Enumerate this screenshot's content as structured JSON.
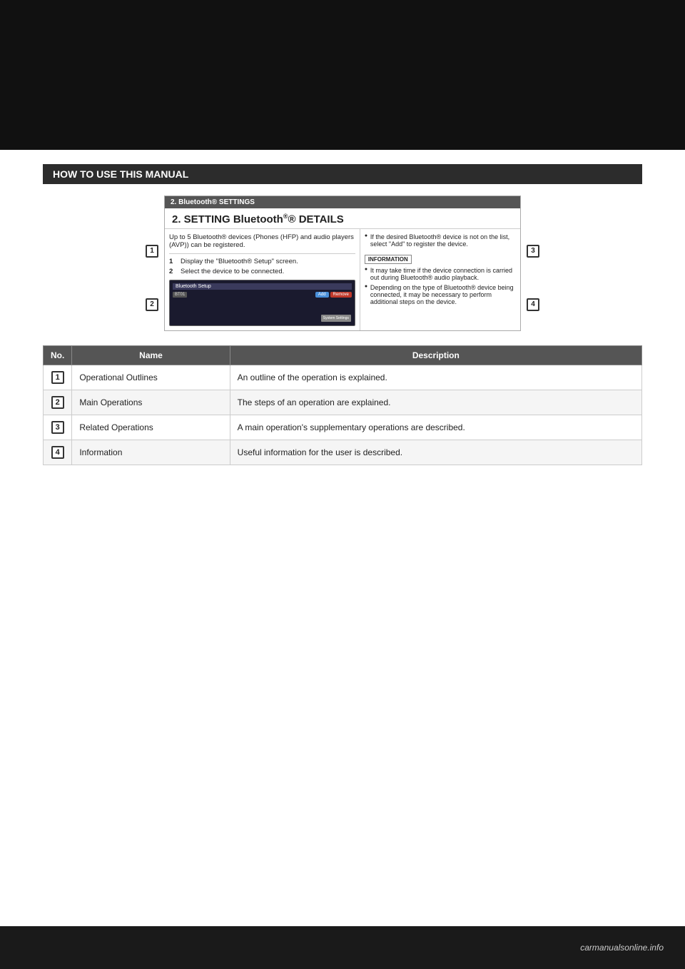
{
  "page": {
    "top_bar_height": 210,
    "section_header": "HOW TO USE THIS MANUAL",
    "diagram": {
      "subheader": "2. Bluetooth® SETTINGS",
      "title": "2. SETTING Bluetooth",
      "title_suffix": "® DETAILS",
      "left_panel": {
        "description": "Up to 5 Bluetooth® devices (Phones (HFP) and audio players (AVP)) can be registered.",
        "steps": [
          "Display the \"Bluetooth® Setup\" screen.",
          "Select the device to be connected."
        ]
      },
      "right_panel": {
        "bullet": "If the desired Bluetooth® device is not on the list, select \"Add\" to register the device.",
        "info_label": "INFORMATION",
        "info_bullets": [
          "It may take time if the device connection is carried out during Bluetooth® audio playback.",
          "Depending on the type of Bluetooth® device being connected, it may be necessary to perform additional steps on the device."
        ]
      },
      "screen_mock": {
        "header": "Bluetooth Setup",
        "item": "BT01",
        "btn_add": "Add",
        "btn_remove": "Remove",
        "btn_system": "System Settings"
      }
    },
    "markers": [
      {
        "id": "1",
        "label": "1"
      },
      {
        "id": "2",
        "label": "2"
      },
      {
        "id": "3",
        "label": "3"
      },
      {
        "id": "4",
        "label": "4"
      }
    ],
    "table": {
      "columns": [
        "No.",
        "Name",
        "Description"
      ],
      "rows": [
        {
          "no": "1",
          "name": "Operational Outlines",
          "description": "An outline of the operation is explained."
        },
        {
          "no": "2",
          "name": "Main Operations",
          "description": "The steps of an operation are explained."
        },
        {
          "no": "3",
          "name": "Related Operations",
          "description": "A main operation's supplementary operations are described."
        },
        {
          "no": "4",
          "name": "Information",
          "description": "Useful information for the user is described."
        }
      ]
    },
    "footer": {
      "logo": "carmanualsonline.info"
    }
  }
}
